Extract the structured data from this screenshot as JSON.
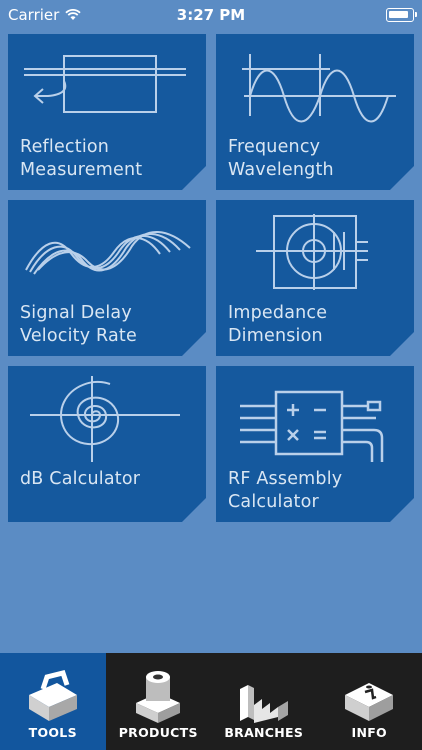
{
  "status_bar": {
    "carrier": "Carrier",
    "time": "3:27 PM"
  },
  "tools": [
    {
      "label": "Reflection\nMeasurement",
      "icon": "reflection-icon"
    },
    {
      "label": "Frequency\nWavelength",
      "icon": "sine-wave-icon"
    },
    {
      "label": "Signal Delay\nVelocity Rate",
      "icon": "signal-waves-icon"
    },
    {
      "label": "Impedance\nDimension",
      "icon": "coax-crosssection-icon"
    },
    {
      "label": "dB Calculator",
      "icon": "spiral-icon"
    },
    {
      "label": "RF Assembly\nCalculator",
      "icon": "calculator-cable-icon"
    }
  ],
  "tabs": [
    {
      "label": "TOOLS",
      "icon": "toolbox-icon",
      "active": true
    },
    {
      "label": "PRODUCTS",
      "icon": "connector-icon",
      "active": false
    },
    {
      "label": "BRANCHES",
      "icon": "factory-icon",
      "active": false
    },
    {
      "label": "INFO",
      "icon": "info-icon",
      "active": false
    }
  ],
  "colors": {
    "background": "#5b8cc4",
    "tile": "#15599e",
    "tabbar": "#1e1e1e",
    "tab_active": "#12569e",
    "line_art": "#b9d0ea"
  }
}
